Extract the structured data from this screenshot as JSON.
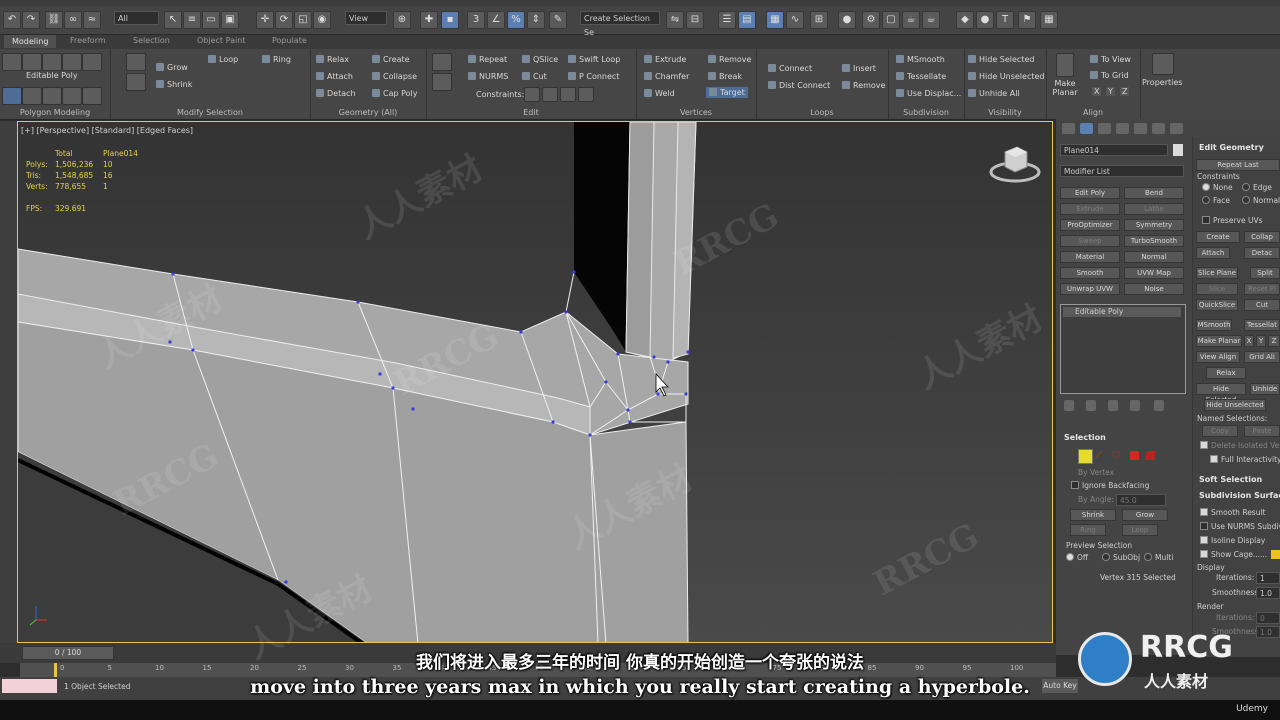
{
  "toolbar": {
    "selection_filter": "All",
    "view_dropdown": "View",
    "named_selection": "Create Selection Se"
  },
  "ribbon_tabs": [
    "Modeling",
    "Freeform",
    "Selection",
    "Object Paint",
    "Populate"
  ],
  "ribbon": {
    "polygon_modeling": {
      "title": "Polygon Modeling",
      "object_label": "Editable Poly"
    },
    "modify_selection": {
      "title": "Modify Selection",
      "grow": "Grow",
      "shrink": "Shrink",
      "loop": "Loop",
      "ring": "Ring"
    },
    "geometry": {
      "title": "Geometry (All)",
      "relax": "Relax",
      "attach": "Attach",
      "detach": "Detach",
      "create": "Create",
      "collapse": "Collapse",
      "cap_poly": "Cap Poly"
    },
    "edit": {
      "title": "Edit",
      "repeat": "Repeat",
      "nurms": "NURMS",
      "constraints": "Constraints:",
      "qslice": "QSlice",
      "cut": "Cut",
      "swift_loop": "Swift Loop",
      "p_connect": "P Connect"
    },
    "vertices": {
      "title": "Vertices",
      "extrude": "Extrude",
      "chamfer": "Chamfer",
      "weld": "Weld",
      "remove": "Remove",
      "break": "Break",
      "target": "Target"
    },
    "loops": {
      "title": "Loops",
      "connect": "Connect",
      "dist_connect": "Dist Connect",
      "insert": "Insert",
      "remove": "Remove"
    },
    "subdivision": {
      "title": "Subdivision",
      "msmooth": "MSmooth",
      "tessellate": "Tessellate",
      "use_displac": "Use Displac..."
    },
    "visibility": {
      "title": "Visibility",
      "hide_selected": "Hide Selected",
      "hide_unselected": "Hide Unselected",
      "unhide_all": "Unhide All"
    },
    "align": {
      "title": "Align",
      "make_planar": "Make Planar",
      "to_view": "To View",
      "to_grid": "To Grid",
      "x": "X",
      "y": "Y",
      "z": "Z"
    },
    "properties": "Properties"
  },
  "viewport": {
    "label": "[+] [Perspective] [Standard] [Edged Faces]",
    "stats": {
      "col_total": "Total",
      "col_object": "Plane014",
      "polys_label": "Polys:",
      "polys_total": "1,506,236",
      "polys_obj": "10",
      "tris_label": "Tris:",
      "tris_total": "1,548,685",
      "tris_obj": "16",
      "verts_label": "Verts:",
      "verts_total": "778,655",
      "verts_obj": "1",
      "fps_label": "FPS:",
      "fps_value": "329.691"
    }
  },
  "command_panel": {
    "object_name": "Plane014",
    "modifier_list": "Modifier List",
    "modifier_buttons": [
      [
        "Edit Poly",
        "Bend"
      ],
      [
        "Extrude",
        "Lathe"
      ],
      [
        "ProOptimizer",
        "Symmetry"
      ],
      [
        "Sweep",
        "TurboSmooth"
      ],
      [
        "Material",
        "Normal"
      ],
      [
        "Smooth",
        "UVW Map"
      ],
      [
        "Unwrap UVW",
        "Noise"
      ]
    ],
    "stack_item": "Editable Poly",
    "selection": {
      "header": "Selection",
      "by_vertex": "By Vertex",
      "ignore_backfacing": "Ignore Backfacing",
      "by_angle": "By Angle:",
      "by_angle_value": "45.0",
      "shrink": "Shrink",
      "grow": "Grow",
      "ring": "Ring",
      "loop": "Loop",
      "preview_selection": "Preview Selection",
      "off": "Off",
      "subobj": "SubObj",
      "multi": "Multi",
      "status": "Vertex 315 Selected"
    },
    "edit_geometry": {
      "header": "Edit Geometry",
      "repeat_last": "Repeat Last",
      "constraints": "Constraints",
      "none": "None",
      "edge": "Edge",
      "face": "Face",
      "normal": "Normal",
      "preserve_uvs": "Preserve UVs",
      "create": "Create",
      "collapse": "Collap",
      "attach": "Attach",
      "detach": "Detac",
      "slice_plane": "Slice Plane",
      "split": "Split",
      "slice": "Slice",
      "reset_plane": "Reset Pl",
      "quickslice": "QuickSlice",
      "cut": "Cut",
      "msmooth": "MSmooth",
      "tessellate": "Tessellat",
      "make_planar": "Make Planar",
      "x": "X",
      "y": "Y",
      "z": "Z",
      "view_align": "View Align",
      "grid_align": "Grid Ali",
      "relax": "Relax",
      "hide_selected": "Hide Selected",
      "unhide": "Unhide",
      "hide_unselected": "Hide Unselected",
      "named_selections": "Named Selections:",
      "copy": "Copy",
      "paste": "Paste",
      "delete_isolated": "Delete Isolated Verte",
      "full_interactivity": "Full Interactivity"
    },
    "soft_selection": "Soft Selection",
    "subdivision_surface": {
      "header": "Subdivision Surface",
      "smooth_result": "Smooth Result",
      "use_nurms": "Use NURMS Subdivisi",
      "isoline": "Isoline Display",
      "show_cage": "Show Cage......",
      "display": "Display",
      "iterations_label": "Iterations:",
      "iterations": "1",
      "smoothness_label": "Smoothness:",
      "smoothness": "1.0",
      "render": "Render",
      "r_iterations": "0",
      "r_smoothness": "1.0"
    }
  },
  "timeline": {
    "frame": "0 / 100",
    "ticks": [
      "0",
      "5",
      "10",
      "15",
      "20",
      "25",
      "30",
      "35",
      "40",
      "45",
      "50",
      "55",
      "60",
      "65",
      "70",
      "75",
      "80",
      "85",
      "90",
      "95",
      "100"
    ]
  },
  "status": {
    "objects_selected": "1 Object Selected",
    "auto_key": "Auto Key"
  },
  "subtitles": {
    "chinese": "我们将进入最多三年的时间 你真的开始创造一个夸张的说法",
    "english": "move into three years max in which you really start creating a hyperbole."
  },
  "watermark": {
    "brand": "RRCG",
    "brand_cn": "人人素材",
    "udemy": "Udemy"
  },
  "colors": {
    "selection_yellow": "#e3c84a",
    "active_blue": "#5b7fb0",
    "vertex_blue": "#3a3adf",
    "mesh_light": "#a8a8a8"
  }
}
